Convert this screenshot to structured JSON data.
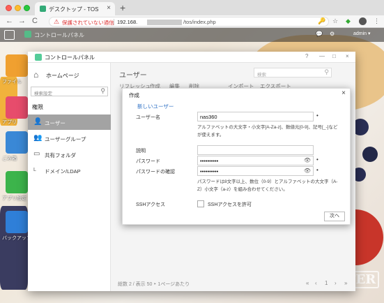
{
  "browser": {
    "tab_title": "デスクトップ - TOS",
    "tab_close": "×",
    "new_tab": "+",
    "nav": {
      "back": "←",
      "forward": "→",
      "reload": "C"
    },
    "security_icon": "⚠",
    "security_text": "保護されていない通信",
    "url_host": "192.168.",
    "url_path": "/tos/index.php",
    "icons": {
      "key": "🔑",
      "star": "☆",
      "shield": "◆",
      "menu": "⋮"
    }
  },
  "taskbar": {
    "app_label": "コントロールパネル",
    "user": "admin ▾",
    "icons": {
      "chat": "💬",
      "settings": "⚙",
      "user": "👤"
    }
  },
  "desktop_icons": [
    {
      "name": "ファイル",
      "color": "#f0a030"
    },
    {
      "name": "アプリ",
      "color": "#e74c6c"
    },
    {
      "name": "ごみ箱",
      "color": "#3a88d6"
    },
    {
      "name": "アプリ設定",
      "color": "#3cb44b"
    },
    {
      "name": "バックアップ",
      "color": "#2f7fd8"
    }
  ],
  "watermark": "TERRA MASTER",
  "control_panel": {
    "title": "コントロールパネル",
    "window_controls": [
      "?",
      "—",
      "□",
      "×"
    ],
    "home": "ホームページ",
    "search_placeholder": "検索設定",
    "search_icon": "⚲",
    "section": "権限",
    "nav_items": [
      {
        "label": "ユーザー",
        "icon": "👤",
        "active": true
      },
      {
        "label": "ユーザーグループ",
        "icon": "👥",
        "active": false
      },
      {
        "label": "共有フォルダ",
        "icon": "▭",
        "active": false
      },
      {
        "label": "ドメイン/LDAP",
        "icon": "L",
        "active": false
      }
    ],
    "main_title": "ユーザー",
    "main_search_placeholder": "検索",
    "toolbar": [
      "リフレッシュ",
      "作成",
      "編集",
      "削除",
      "インポート",
      "エクスポート"
    ],
    "footer": "総数 2 / 表示  50  ‣ 1ページあたり",
    "pager": {
      "first": "«",
      "prev": "‹",
      "page": "1",
      "next": "›",
      "last": "»"
    }
  },
  "dialog": {
    "title": "作成",
    "close": "×",
    "tab": "新しいユーザー",
    "username_label": "ユーザー名",
    "username_value": "nas360",
    "username_hint": "アルファベットの大文字・小文字[A-Za-z]、数値元[0-9]、記号[_-]などが使えます。",
    "description_label": "説明",
    "description_value": "",
    "password_label": "パスワード",
    "password_value": "••••••••••",
    "password_confirm_label": "パスワードの確認",
    "password_confirm_value": "••••••••••",
    "password_hint": "パスワードは8文字以上、数位（0-9）とアルファベットの大文字（A-Z）小文字（a-z）を組み合わせてください。",
    "ssh_label": "SSHアクセス",
    "ssh_checkbox_label": "SSHアクセスを許可",
    "ssh_checked": false,
    "required_mark": "•",
    "eye_icon": "👁",
    "next_button": "次へ"
  }
}
